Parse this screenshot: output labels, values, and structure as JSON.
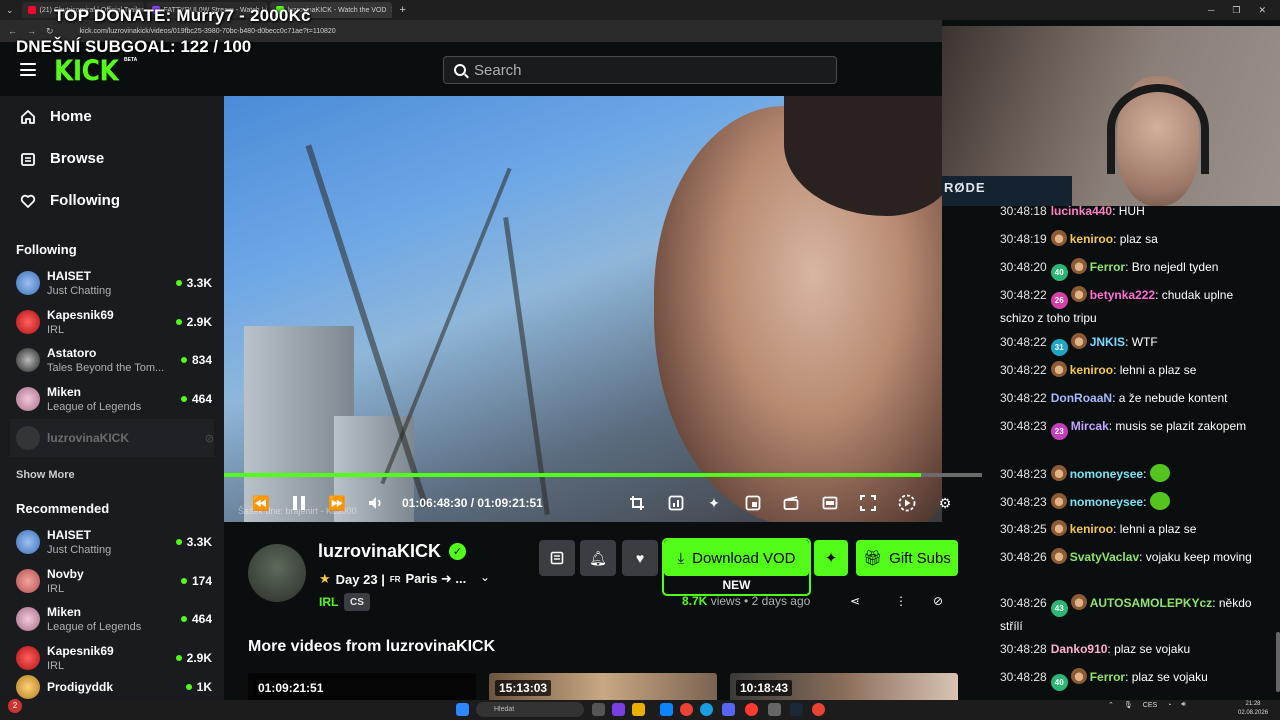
{
  "browser": {
    "tabs": [
      {
        "title": "(21) Chytrisomiraf | Official Trailer",
        "color": "#ff0033"
      },
      {
        "title": "FATTYRUL0W Stream - Watch Li",
        "color": "#9146ff"
      },
      {
        "title": "luzrovinaKICK - Watch the VOD",
        "color": "#53fc18",
        "active": true
      }
    ],
    "url": "kick.com/luzrovinakick/videos/019fbc25-3980-70bc-b480-d0becc0c71ae?t=110820"
  },
  "overlay": {
    "top_donate": "TOP DONATE: Murry7 - 2000Kč",
    "subgoal": "DNEŠNÍ SUBGOAL: 122 / 100"
  },
  "header": {
    "logo": "KICK",
    "logo_beta": "BETA",
    "search_placeholder": "Search"
  },
  "sidebar": {
    "nav": [
      {
        "label": "Home",
        "icon": "home-icon"
      },
      {
        "label": "Browse",
        "icon": "browse-icon"
      },
      {
        "label": "Following",
        "icon": "heart-icon"
      }
    ],
    "following_title": "Following",
    "following": [
      {
        "name": "HAISET",
        "category": "Just Chatting",
        "viewers": "3.3K",
        "color": "#5b8bd6"
      },
      {
        "name": "Kapesnik69",
        "category": "IRL",
        "viewers": "2.9K",
        "color": "#d81e1e"
      },
      {
        "name": "Astatoro",
        "category": "Tales Beyond the Tom...",
        "viewers": "834",
        "color": "#444444"
      },
      {
        "name": "Miken",
        "category": "League of Legends",
        "viewers": "464",
        "color": "#c9a0b4"
      },
      {
        "name": "luzrovinaKICK",
        "category": "",
        "viewers": "",
        "color": "#555555"
      }
    ],
    "show_more": "Show More",
    "recommended_title": "Recommended",
    "recommended": [
      {
        "name": "HAISET",
        "category": "Just Chatting",
        "viewers": "3.3K",
        "color": "#5b8bd6"
      },
      {
        "name": "Novby",
        "category": "IRL",
        "viewers": "174",
        "color": "#d4736f"
      },
      {
        "name": "Miken",
        "category": "League of Legends",
        "viewers": "464",
        "color": "#c9a0b4"
      },
      {
        "name": "Kapesnik69",
        "category": "IRL",
        "viewers": "2.9K",
        "color": "#d81e1e"
      },
      {
        "name": "Prodigyddk",
        "category": "",
        "viewers": "1K",
        "color": "#e5a93b"
      }
    ]
  },
  "player": {
    "current_time": "01:06:48:30",
    "separator": "/",
    "duration": "01:09:21:51",
    "progress_pct": 92,
    "watermark": "Šašek dne: brajenirt - Kč3000"
  },
  "video_info": {
    "channel": "luzrovinaKICK",
    "title_prefix": "Day 23 |",
    "flag": "FR",
    "title_rest": "Paris ➜ ...",
    "category": "IRL",
    "language": "CS",
    "download_label": "Download VOD",
    "new_label": "NEW",
    "gift_label": "Gift Subs",
    "views": "8.7K",
    "views_word": "views",
    "age": "2 days ago"
  },
  "more_videos": {
    "title": "More videos from luzrovinaKICK",
    "durations": [
      "01:09:21:51",
      "15:13:03",
      "10:18:43"
    ]
  },
  "webcam": {
    "mic_brand": "RØDE"
  },
  "chat": [
    {
      "ts": "30:48:18",
      "user": "lucinka440",
      "color": "#ff80c0",
      "text": ": HUH",
      "badge": null,
      "monkey": false
    },
    {
      "ts": "30:48:19",
      "user": "keniroo",
      "color": "#f5c84c",
      "text": ": plaz sa",
      "badge": null,
      "monkey": true
    },
    {
      "ts": "30:48:20",
      "user": "Ferror",
      "color": "#8fe36a",
      "text": ": Bro nejedl tyden",
      "badge": {
        "n": "40",
        "c": "#2bb673"
      },
      "monkey": true
    },
    {
      "ts": "30:48:22",
      "user": "betynka222",
      "color": "#ff6fd0",
      "text": ": chudak uplne schizo z toho tripu",
      "badge": {
        "n": "26",
        "c": "#d63fa6"
      },
      "monkey": true
    },
    {
      "ts": "30:48:22",
      "user": "JNKIS",
      "color": "#7ad9ff",
      "text": ": WTF",
      "badge": {
        "n": "31",
        "c": "#1fa6c4"
      },
      "monkey": true
    },
    {
      "ts": "30:48:22",
      "user": "keniroo",
      "color": "#f5c84c",
      "text": ": lehni a plaz se",
      "badge": null,
      "monkey": true
    },
    {
      "ts": "30:48:22",
      "user": "DonRoaaN",
      "color": "#a6b8ff",
      "text": ": a že nebude kontent",
      "badge": null,
      "monkey": false
    },
    {
      "ts": "30:48:23",
      "user": "Mircak",
      "color": "#c2a3ff",
      "text": ": musis se plazit zakopem",
      "badge": {
        "n": "23",
        "c": "#c43fbf"
      },
      "monkey": false
    },
    {
      "ts": "30:48:23",
      "user": "nomoneysee",
      "color": "#7ae3f0",
      "text": ": ",
      "badge": null,
      "monkey": true,
      "emote": true
    },
    {
      "ts": "30:48:23",
      "user": "nomoneysee",
      "color": "#7ae3f0",
      "text": ": ",
      "badge": null,
      "monkey": true,
      "emote": true
    },
    {
      "ts": "30:48:25",
      "user": "keniroo",
      "color": "#f5c84c",
      "text": ": lehni a plaz se",
      "badge": null,
      "monkey": true
    },
    {
      "ts": "30:48:26",
      "user": "SvatyVaclav",
      "color": "#8fe36a",
      "text": ": vojaku keep moving",
      "badge": null,
      "monkey": true
    },
    {
      "ts": "30:48:26",
      "user": "AUTOSAMOLEPKYcz",
      "color": "#8fe36a",
      "text": ": někdo střílí",
      "badge": {
        "n": "43",
        "c": "#2bb673"
      },
      "monkey": true
    },
    {
      "ts": "30:48:28",
      "user": "Danko910",
      "color": "#ffb0d0",
      "text": ": plaz se vojaku",
      "badge": null,
      "monkey": false
    },
    {
      "ts": "30:48:28",
      "user": "Ferror",
      "color": "#8fe36a",
      "text": ": plaz se vojaku",
      "badge": {
        "n": "40",
        "c": "#2bb673"
      },
      "monkey": true
    }
  ],
  "taskbar": {
    "search_placeholder": "Hledat",
    "lang": "CES",
    "time": "21:28",
    "date": "02.08.2026"
  }
}
